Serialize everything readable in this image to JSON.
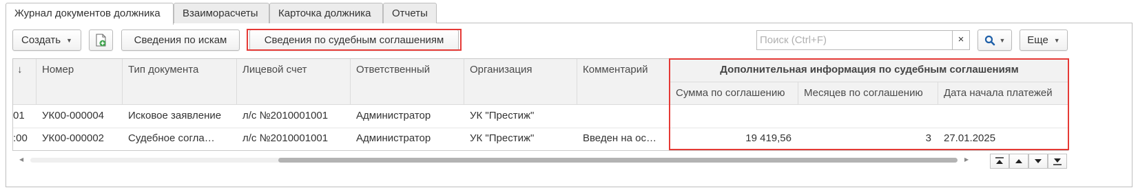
{
  "tabs": [
    {
      "label": "Журнал документов должника",
      "active": true
    },
    {
      "label": "Взаиморасчеты",
      "active": false
    },
    {
      "label": "Карточка должника",
      "active": false
    },
    {
      "label": "Отчеты",
      "active": false
    }
  ],
  "toolbar": {
    "create_label": "Создать",
    "claims_label": "Сведения по искам",
    "agreements_label": "Сведения по судебным соглашениям",
    "search_placeholder": "Поиск (Ctrl+F)",
    "clear_label": "×",
    "more_label": "Еще"
  },
  "table": {
    "sort_indicator": "↓",
    "columns": {
      "number": "Номер",
      "doc_type": "Тип документа",
      "account": "Лицевой счет",
      "responsible": "Ответственный",
      "organization": "Организация",
      "comment": "Комментарий",
      "group_title": "Дополнительная информация по судебным соглашениям",
      "sum": "Сумма по соглашению",
      "months": "Месяцев по соглашению",
      "start_date": "Дата начала платежей"
    },
    "rows": [
      {
        "date_frag": "01",
        "number": "УК00-000004",
        "doc_type": "Исковое заявление",
        "account": "л/с №2010001001",
        "responsible": "Администратор",
        "organization": "УК \"Престиж\"",
        "comment": "",
        "sum": "",
        "months": "",
        "start_date": ""
      },
      {
        "date_frag": ":00",
        "number": "УК00-000002",
        "doc_type": "Судебное согла…",
        "account": "л/с №2010001001",
        "responsible": "Администратор",
        "organization": "УК \"Престиж\"",
        "comment": "Введен на ос…",
        "sum": "19 419,56",
        "months": "3",
        "start_date": "27.01.2025"
      }
    ]
  },
  "highlight_color": "#e53935"
}
